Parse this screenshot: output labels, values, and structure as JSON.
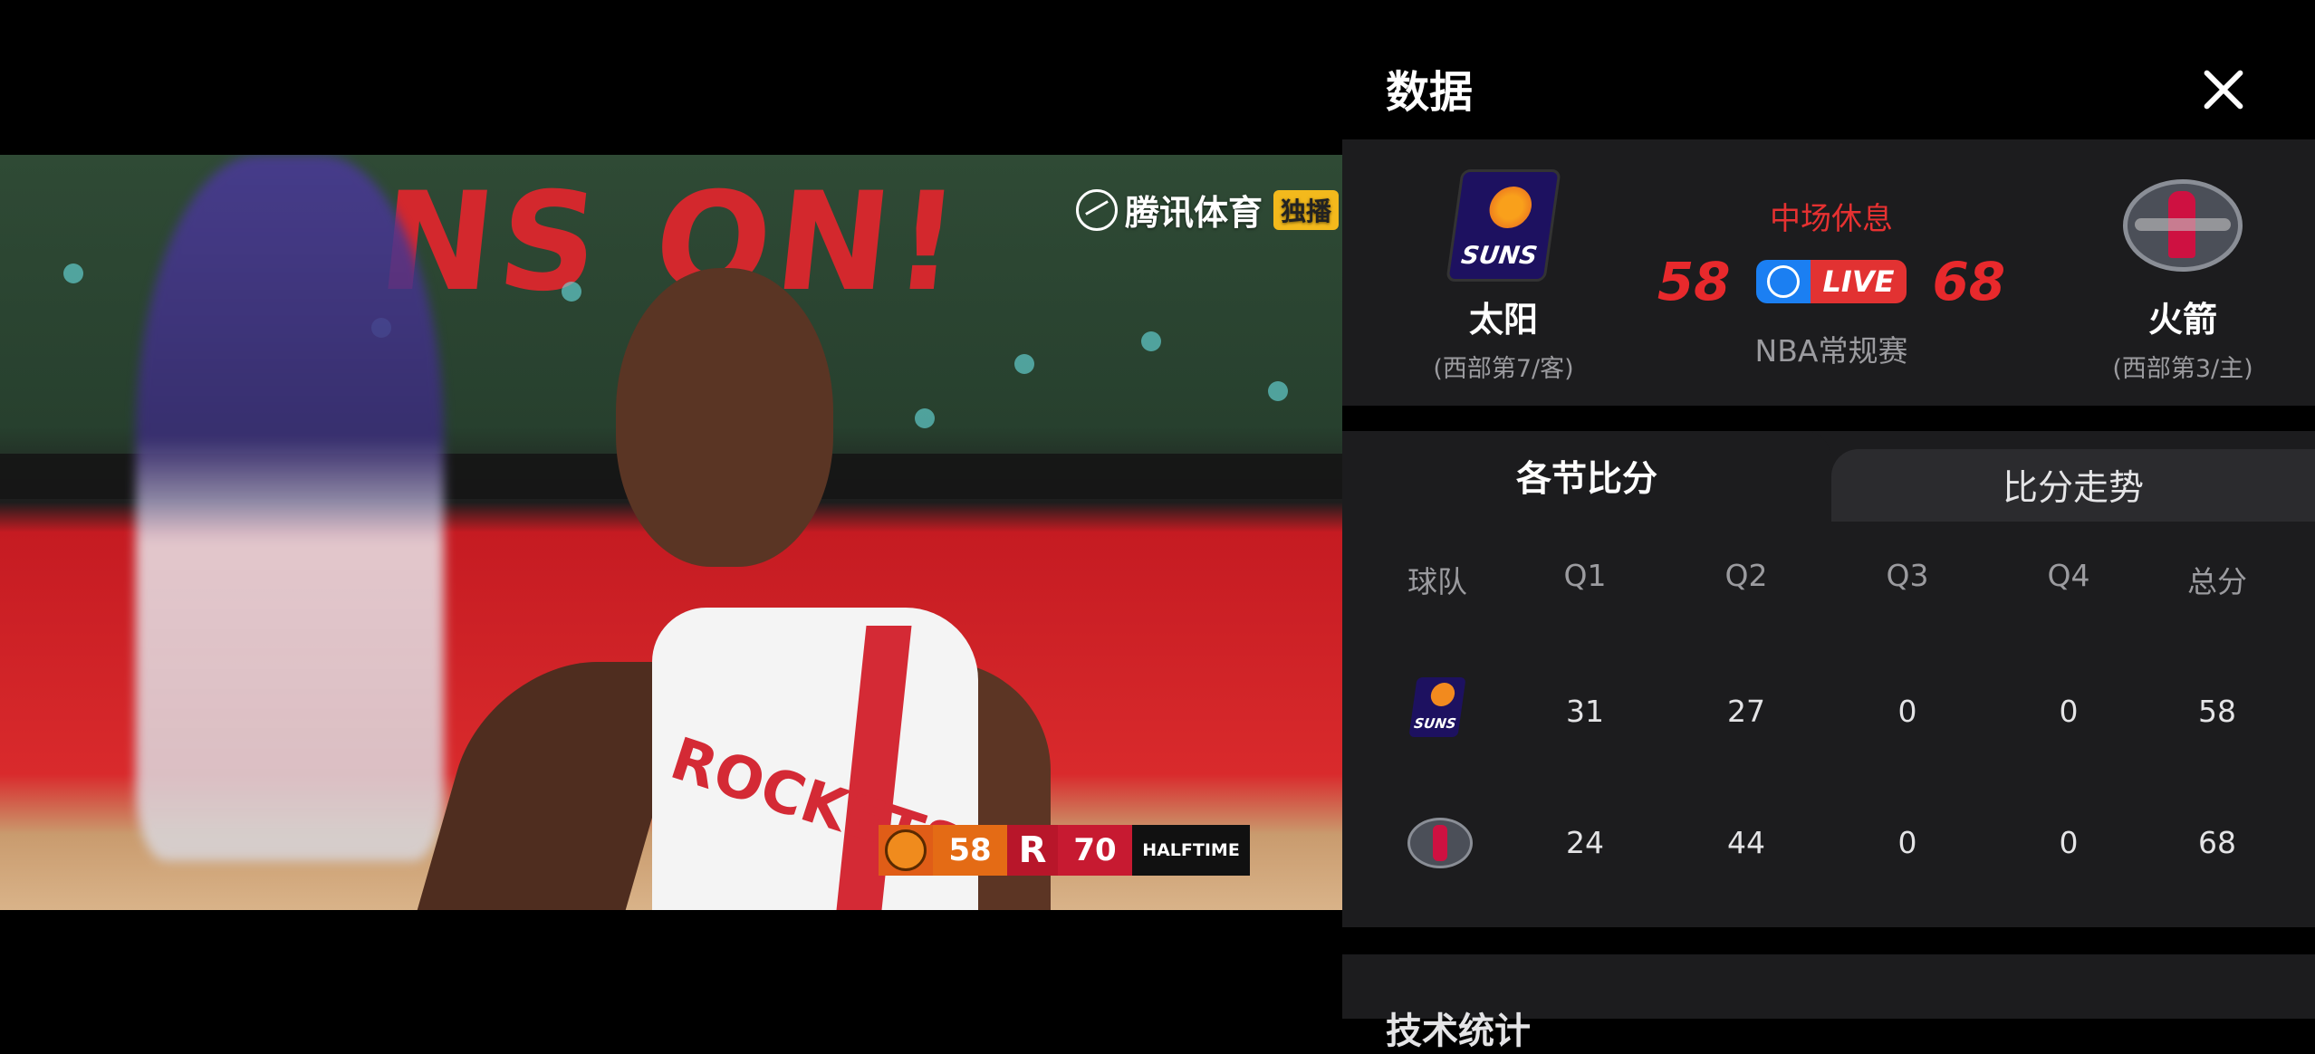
{
  "video": {
    "watermark": {
      "brand": "腾讯体育",
      "badge": "独播"
    },
    "scorebug": {
      "away_score": "58",
      "home_score": "70",
      "status": "HALFTIME"
    },
    "banner": "NS ON!",
    "jersey_text": "ROCKETS"
  },
  "panel": {
    "title": "数据",
    "close_icon": "close-icon",
    "match": {
      "status": "中场休息",
      "league": "NBA常规赛",
      "live_label": "LIVE",
      "away": {
        "name": "太阳",
        "standing": "(西部第7/客)",
        "score": "58",
        "logo_text": "SUNS"
      },
      "home": {
        "name": "火箭",
        "standing": "(西部第3/主)",
        "score": "68"
      }
    },
    "tabs": {
      "active": "各节比分",
      "inactive": "比分走势"
    },
    "quarter_table": {
      "headers": [
        "球队",
        "Q1",
        "Q2",
        "Q3",
        "Q4",
        "总分"
      ],
      "rows": [
        {
          "team": "suns-logo",
          "q1": "31",
          "q2": "27",
          "q3": "0",
          "q4": "0",
          "total": "58"
        },
        {
          "team": "rockets-logo",
          "q1": "24",
          "q2": "44",
          "q3": "0",
          "q4": "0",
          "total": "68"
        }
      ]
    },
    "next_section_label": "技术统计"
  },
  "colors": {
    "live_red": "#e23232",
    "live_blue": "#1b7ff2",
    "score_red": "#e8292c",
    "panel_bg": "#1c1c1e",
    "muted_text": "#9b9b9f"
  }
}
